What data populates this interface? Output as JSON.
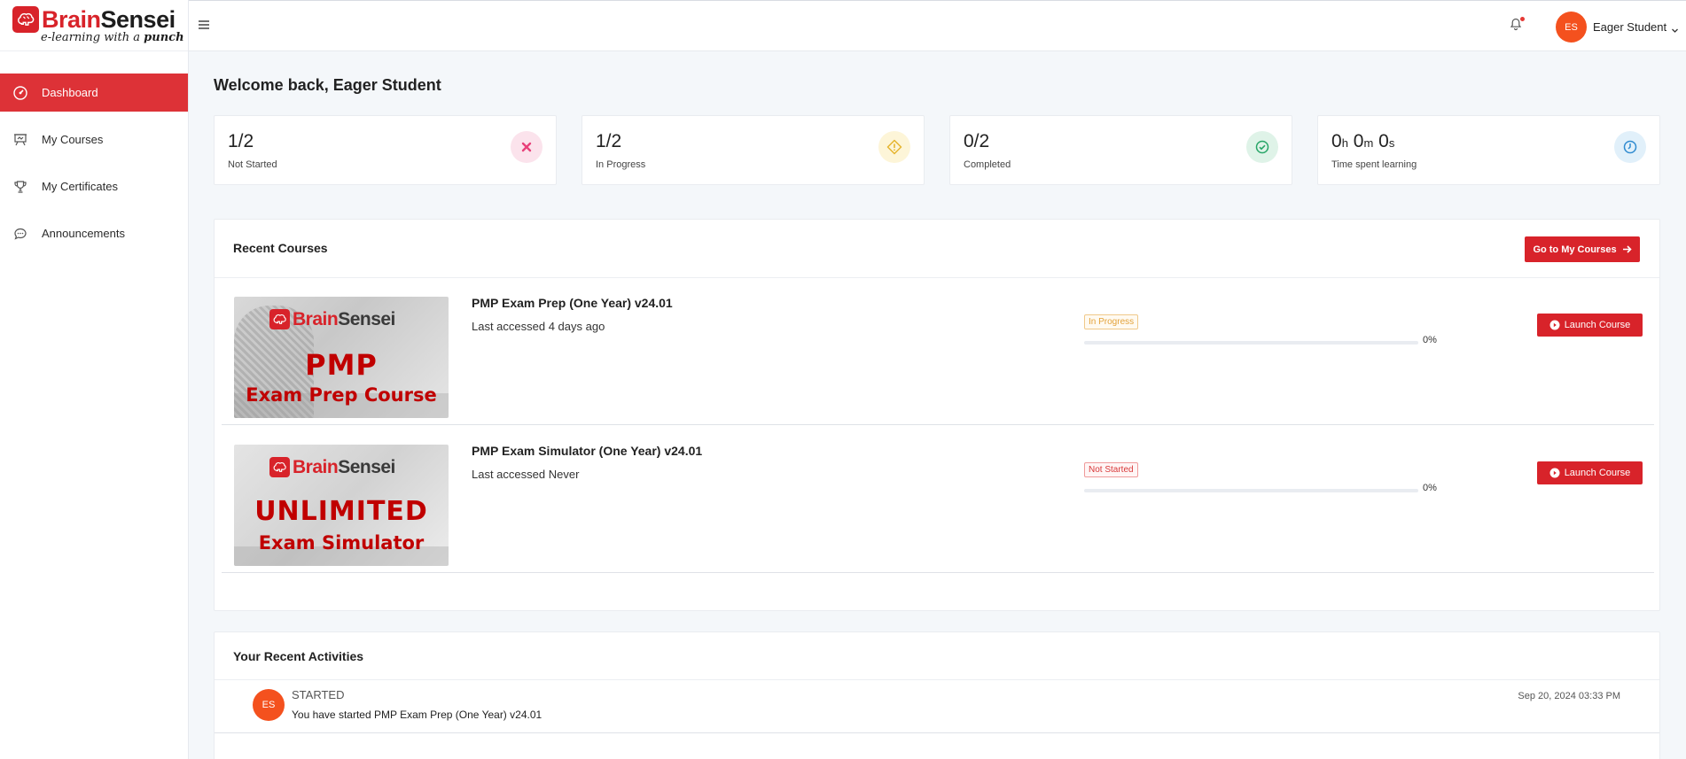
{
  "brand": {
    "name_part1": "Brain",
    "name_part2": "Sensei",
    "tagline_part1": "e-learning with a ",
    "tagline_part2": "punch",
    "primary_color": "#d8232a"
  },
  "sidebar": {
    "items": [
      {
        "label": "Dashboard",
        "icon": "dashboard-gauge-icon",
        "active": true
      },
      {
        "label": "My Courses",
        "icon": "presentation-board-icon",
        "active": false
      },
      {
        "label": "My Certificates",
        "icon": "trophy-icon",
        "active": false
      },
      {
        "label": "Announcements",
        "icon": "chat-bubble-icon",
        "active": false
      }
    ]
  },
  "topbar": {
    "user_initials": "ES",
    "user_name": "Eager Student"
  },
  "welcome": "Welcome back, Eager Student",
  "stats": [
    {
      "value": "1/2",
      "label": "Not Started",
      "icon": "close-x-icon",
      "color": "#e8417a",
      "bg": "#fbe3ec"
    },
    {
      "value": "1/2",
      "label": "In Progress",
      "icon": "warning-diamond-icon",
      "color": "#e6b530",
      "bg": "#fdf5d8"
    },
    {
      "value": "0/2",
      "label": "Completed",
      "icon": "check-circle-icon",
      "color": "#27a567",
      "bg": "#dff3e8"
    },
    {
      "time": {
        "h": "0",
        "h_unit": "h",
        "m": "0",
        "m_unit": "m",
        "s": "0",
        "s_unit": "s"
      },
      "label": "Time spent learning",
      "icon": "clock-icon",
      "color": "#2f8bd0",
      "bg": "#e1f0fa"
    }
  ],
  "recent_courses": {
    "title": "Recent Courses",
    "goto_label": "Go to My Courses",
    "launch_label": "Launch Course",
    "courses": [
      {
        "name": "PMP Exam Prep (One Year) v24.01",
        "accessed": "Last accessed 4 days ago",
        "status": "In Progress",
        "progress": 0,
        "progress_text": "0%",
        "thumb_line1": "PMP",
        "thumb_line2": "Exam Prep Course"
      },
      {
        "name": "PMP Exam Simulator (One Year) v24.01",
        "accessed": "Last accessed Never",
        "status": "Not Started",
        "progress": 0,
        "progress_text": "0%",
        "thumb_line1": "UNLIMITED",
        "thumb_line2": "Exam Simulator"
      }
    ]
  },
  "activities": {
    "title": "Your Recent Activities",
    "items": [
      {
        "initials": "ES",
        "type": "STARTED",
        "description": "You have started PMP Exam Prep (One Year) v24.01",
        "time": "Sep 20, 2024 03:33 PM"
      }
    ]
  }
}
